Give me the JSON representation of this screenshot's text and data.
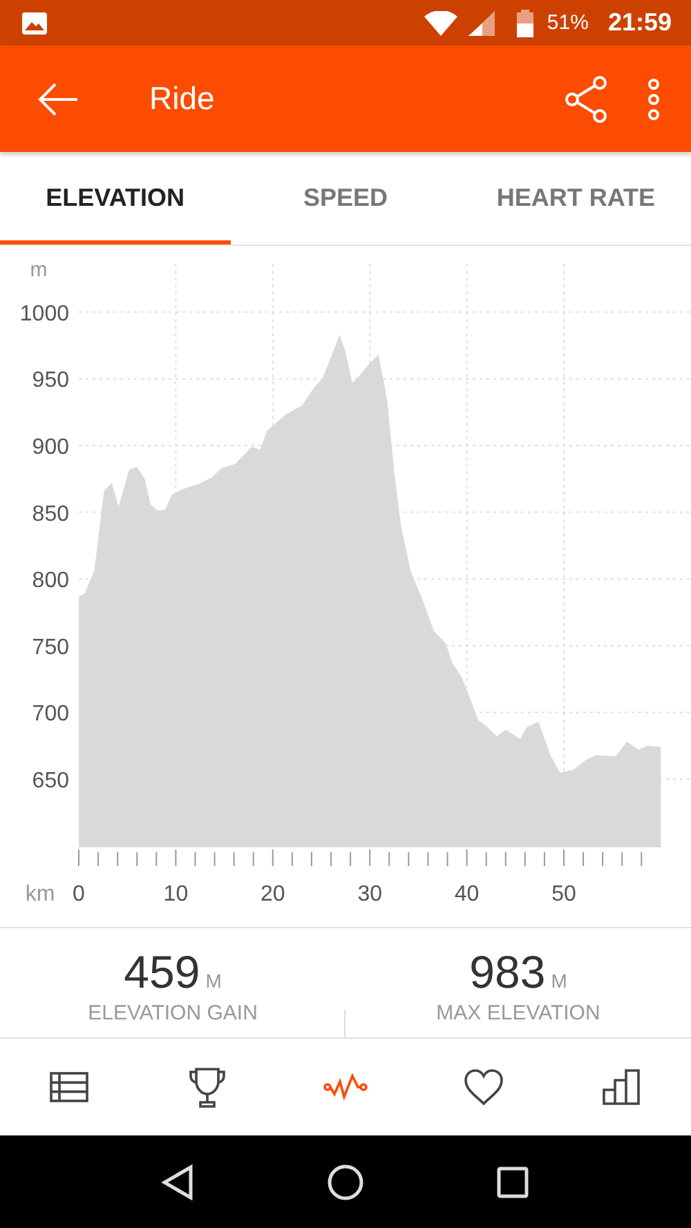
{
  "status_bar": {
    "battery": "51%",
    "time": "21:59"
  },
  "app_bar": {
    "title": "Ride"
  },
  "tabs": [
    {
      "label": "ELEVATION",
      "selected": true
    },
    {
      "label": "SPEED",
      "selected": false
    },
    {
      "label": "HEART RATE",
      "selected": false
    }
  ],
  "chart": {
    "chart_data": {
      "type": "area",
      "xlabel": "km",
      "ylabel": "m",
      "x": [
        0,
        0.6,
        1.6,
        2.6,
        3.4,
        4.1,
        5.2,
        6,
        6.8,
        7.4,
        8.1,
        8.9,
        9.6,
        10.6,
        12.3,
        13.7,
        14.7,
        16.1,
        17.8,
        18.7,
        19.4,
        21.3,
        23,
        24.2,
        25.1,
        26.1,
        26.9,
        27.5,
        28.2,
        28.9,
        29.9,
        30.9,
        31.8,
        32.5,
        33.2,
        34.2,
        35.4,
        36.6,
        37.8,
        38.5,
        39.5,
        40.2,
        41.2,
        42.1,
        43.1,
        44,
        45.5,
        46.2,
        47.4,
        48.6,
        49.6,
        51,
        52.4,
        53.4,
        55.3,
        56.5,
        57.7,
        58.6,
        60
      ],
      "series": [
        {
          "color": "#d9d9d9",
          "values": [
            787,
            789,
            806,
            866,
            872,
            854,
            882,
            884,
            875,
            856,
            851,
            852,
            863,
            867,
            871,
            876,
            883,
            886,
            899,
            897,
            911,
            923,
            930,
            943,
            950,
            968,
            983,
            970,
            947,
            952,
            961,
            968,
            934,
            882,
            840,
            806,
            785,
            761,
            752,
            737,
            726,
            713,
            694,
            689,
            682,
            687,
            680,
            689,
            693,
            668,
            655,
            657,
            665,
            668,
            667,
            678,
            672,
            675,
            674
          ]
        }
      ],
      "grid": true,
      "xlim": [
        0,
        60
      ],
      "ylim": [
        600,
        1036
      ],
      "xticks": [
        0,
        10,
        20,
        30,
        40,
        50
      ],
      "yticks": [
        650,
        700,
        750,
        800,
        850,
        900,
        950,
        1000
      ]
    }
  },
  "stats": [
    {
      "value": "459",
      "unit": "M",
      "label": "ELEVATION GAIN"
    },
    {
      "value": "983",
      "unit": "M",
      "label": "MAX ELEVATION"
    }
  ],
  "bottom_nav": [
    {
      "selected": false
    },
    {
      "selected": false
    },
    {
      "selected": true
    },
    {
      "selected": false
    },
    {
      "selected": false
    }
  ]
}
